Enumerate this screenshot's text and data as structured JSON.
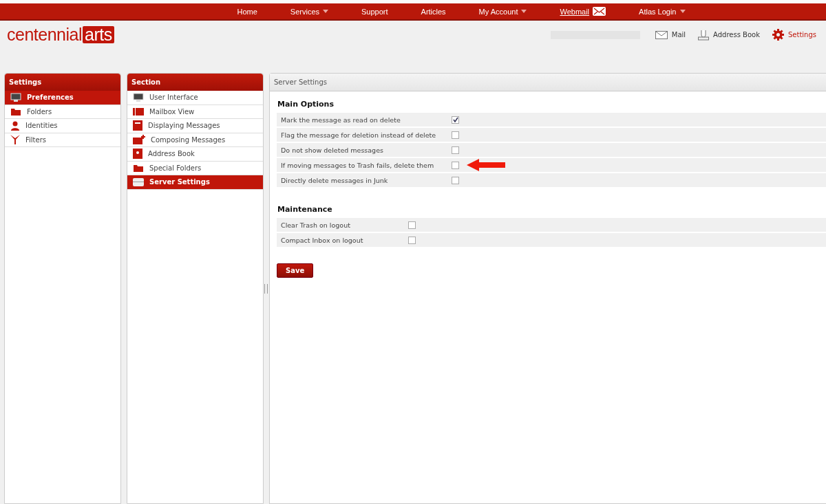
{
  "nav": [
    {
      "label": "Home",
      "dropdown": false,
      "underlined": false,
      "kind": "plain"
    },
    {
      "label": "Services",
      "dropdown": true,
      "underlined": false,
      "kind": "plain"
    },
    {
      "label": "Support",
      "dropdown": false,
      "underlined": false,
      "kind": "plain"
    },
    {
      "label": "Articles",
      "dropdown": false,
      "underlined": false,
      "kind": "plain"
    },
    {
      "label": "My Account",
      "dropdown": true,
      "underlined": false,
      "kind": "plain"
    },
    {
      "label": "Webmail",
      "dropdown": false,
      "underlined": true,
      "kind": "mail"
    },
    {
      "label": "Atlas Login",
      "dropdown": true,
      "underlined": false,
      "kind": "plain"
    }
  ],
  "logo": {
    "word": "centennial",
    "boxed": "arts"
  },
  "toolbar": [
    {
      "label": "Mail",
      "kind": "mail",
      "selected": false
    },
    {
      "label": "Address Book",
      "kind": "contacts",
      "selected": false
    },
    {
      "label": "Settings",
      "kind": "gear",
      "selected": true
    }
  ],
  "settings_panel": {
    "title": "Settings",
    "items": [
      {
        "label": "Preferences",
        "kind": "monitor",
        "selected": true
      },
      {
        "label": "Folders",
        "kind": "folder",
        "selected": false
      },
      {
        "label": "Identities",
        "kind": "person",
        "selected": false
      },
      {
        "label": "Filters",
        "kind": "filter",
        "selected": false
      }
    ]
  },
  "section_panel": {
    "title": "Section",
    "items": [
      {
        "label": "User Interface",
        "kind": "monitor",
        "selected": false
      },
      {
        "label": "Mailbox View",
        "kind": "list",
        "selected": false
      },
      {
        "label": "Displaying Messages",
        "kind": "page",
        "selected": false
      },
      {
        "label": "Composing Messages",
        "kind": "compose",
        "selected": false
      },
      {
        "label": "Address Book",
        "kind": "book",
        "selected": false
      },
      {
        "label": "Special Folders",
        "kind": "folder",
        "selected": false
      },
      {
        "label": "Server Settings",
        "kind": "server",
        "selected": true
      }
    ]
  },
  "main_panel": {
    "title": "Server Settings",
    "groups": [
      {
        "title": "Main Options",
        "wide": true,
        "options": [
          {
            "label": "Mark the message as read on delete",
            "checked": true,
            "pointed": false
          },
          {
            "label": "Flag the message for deletion instead of delete",
            "checked": false,
            "pointed": false
          },
          {
            "label": "Do not show deleted messages",
            "checked": false,
            "pointed": false
          },
          {
            "label": "If moving messages to Trash fails, delete them",
            "checked": false,
            "pointed": true
          },
          {
            "label": "Directly delete messages in Junk",
            "checked": false,
            "pointed": false
          }
        ]
      },
      {
        "title": "Maintenance",
        "wide": false,
        "options": [
          {
            "label": "Clear Trash on logout",
            "checked": false,
            "pointed": false
          },
          {
            "label": "Compact Inbox on logout",
            "checked": false,
            "pointed": false
          }
        ]
      }
    ],
    "save": "Save"
  }
}
